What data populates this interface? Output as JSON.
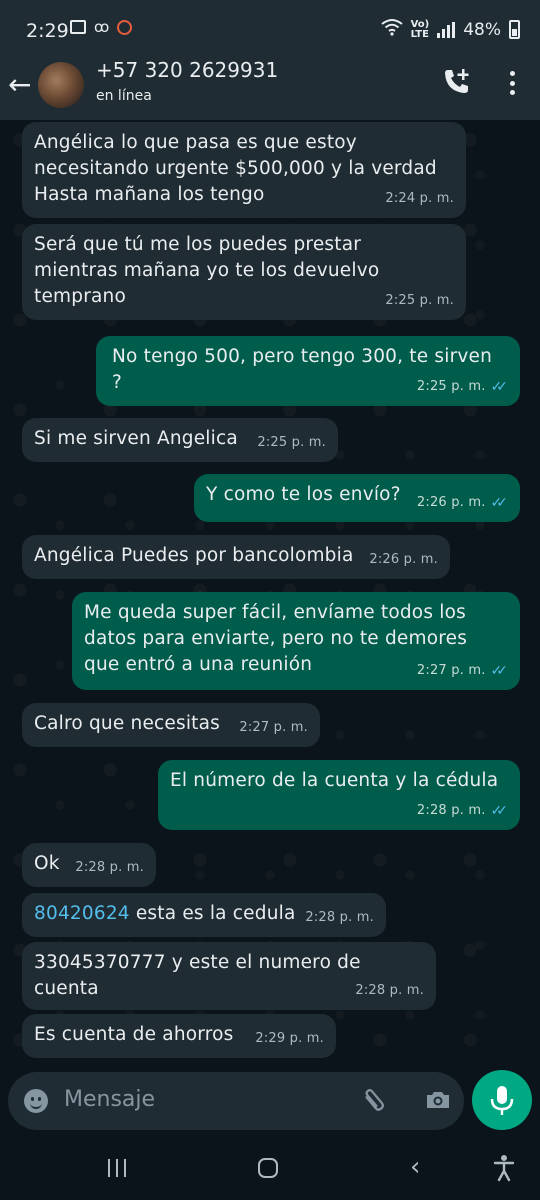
{
  "status_bar": {
    "time": "2:29",
    "lte": "LTE",
    "battery": "48%"
  },
  "header": {
    "contact_name": "+57 320 2629931",
    "contact_status": "en línea"
  },
  "messages": [
    {
      "direction": "in",
      "text": "Angélica lo que pasa es que estoy necesitando urgente $500,000 y la verdad Hasta mañana los tengo",
      "time": "2:24 p. m."
    },
    {
      "direction": "in",
      "text": "Será que tú me los puedes prestar mientras mañana yo te los devuelvo temprano",
      "time": "2:25 p. m."
    },
    {
      "direction": "out",
      "text": "No tengo 500, pero tengo 300, te sirven ?",
      "time": "2:25 p. m.",
      "read": true
    },
    {
      "direction": "in",
      "text": "Si me sirven Angelica",
      "time": "2:25 p. m."
    },
    {
      "direction": "out",
      "text": "Y como te los envío?",
      "time": "2:26 p. m.",
      "read": true
    },
    {
      "direction": "in",
      "text": "Angélica Puedes por bancolombia",
      "time": "2:26 p. m."
    },
    {
      "direction": "out",
      "text": "Me queda super fácil, envíame todos los datos para enviarte, pero no te demores que entró a una reunión",
      "time": "2:27 p. m.",
      "read": true
    },
    {
      "direction": "in",
      "text": "Calro que necesitas",
      "time": "2:27 p. m."
    },
    {
      "direction": "out",
      "text": "El número de la cuenta y la cédula",
      "time": "2:28 p. m.",
      "read": true
    },
    {
      "direction": "in",
      "text": "Ok",
      "time": "2:28 p. m."
    },
    {
      "direction": "in",
      "link": "80420624",
      "text": " esta es la cedula",
      "time": "2:28 p. m."
    },
    {
      "direction": "in",
      "text": "33045370777 y este el numero de cuenta",
      "time": "2:28 p. m."
    },
    {
      "direction": "in",
      "text": "Es cuenta de ahorros",
      "time": "2:29 p. m."
    }
  ],
  "input": {
    "placeholder": "Mensaje"
  },
  "colors": {
    "background": "#0b141a",
    "incoming_bubble": "#202c33",
    "outgoing_bubble": "#005c4b",
    "accent": "#00a884",
    "read_ticks": "#53bdeb"
  },
  "icons": [
    "back-arrow-icon",
    "add-call-icon",
    "more-options-icon",
    "emoji-icon",
    "attach-icon",
    "camera-icon",
    "mic-icon",
    "read-ticks-icon"
  ]
}
